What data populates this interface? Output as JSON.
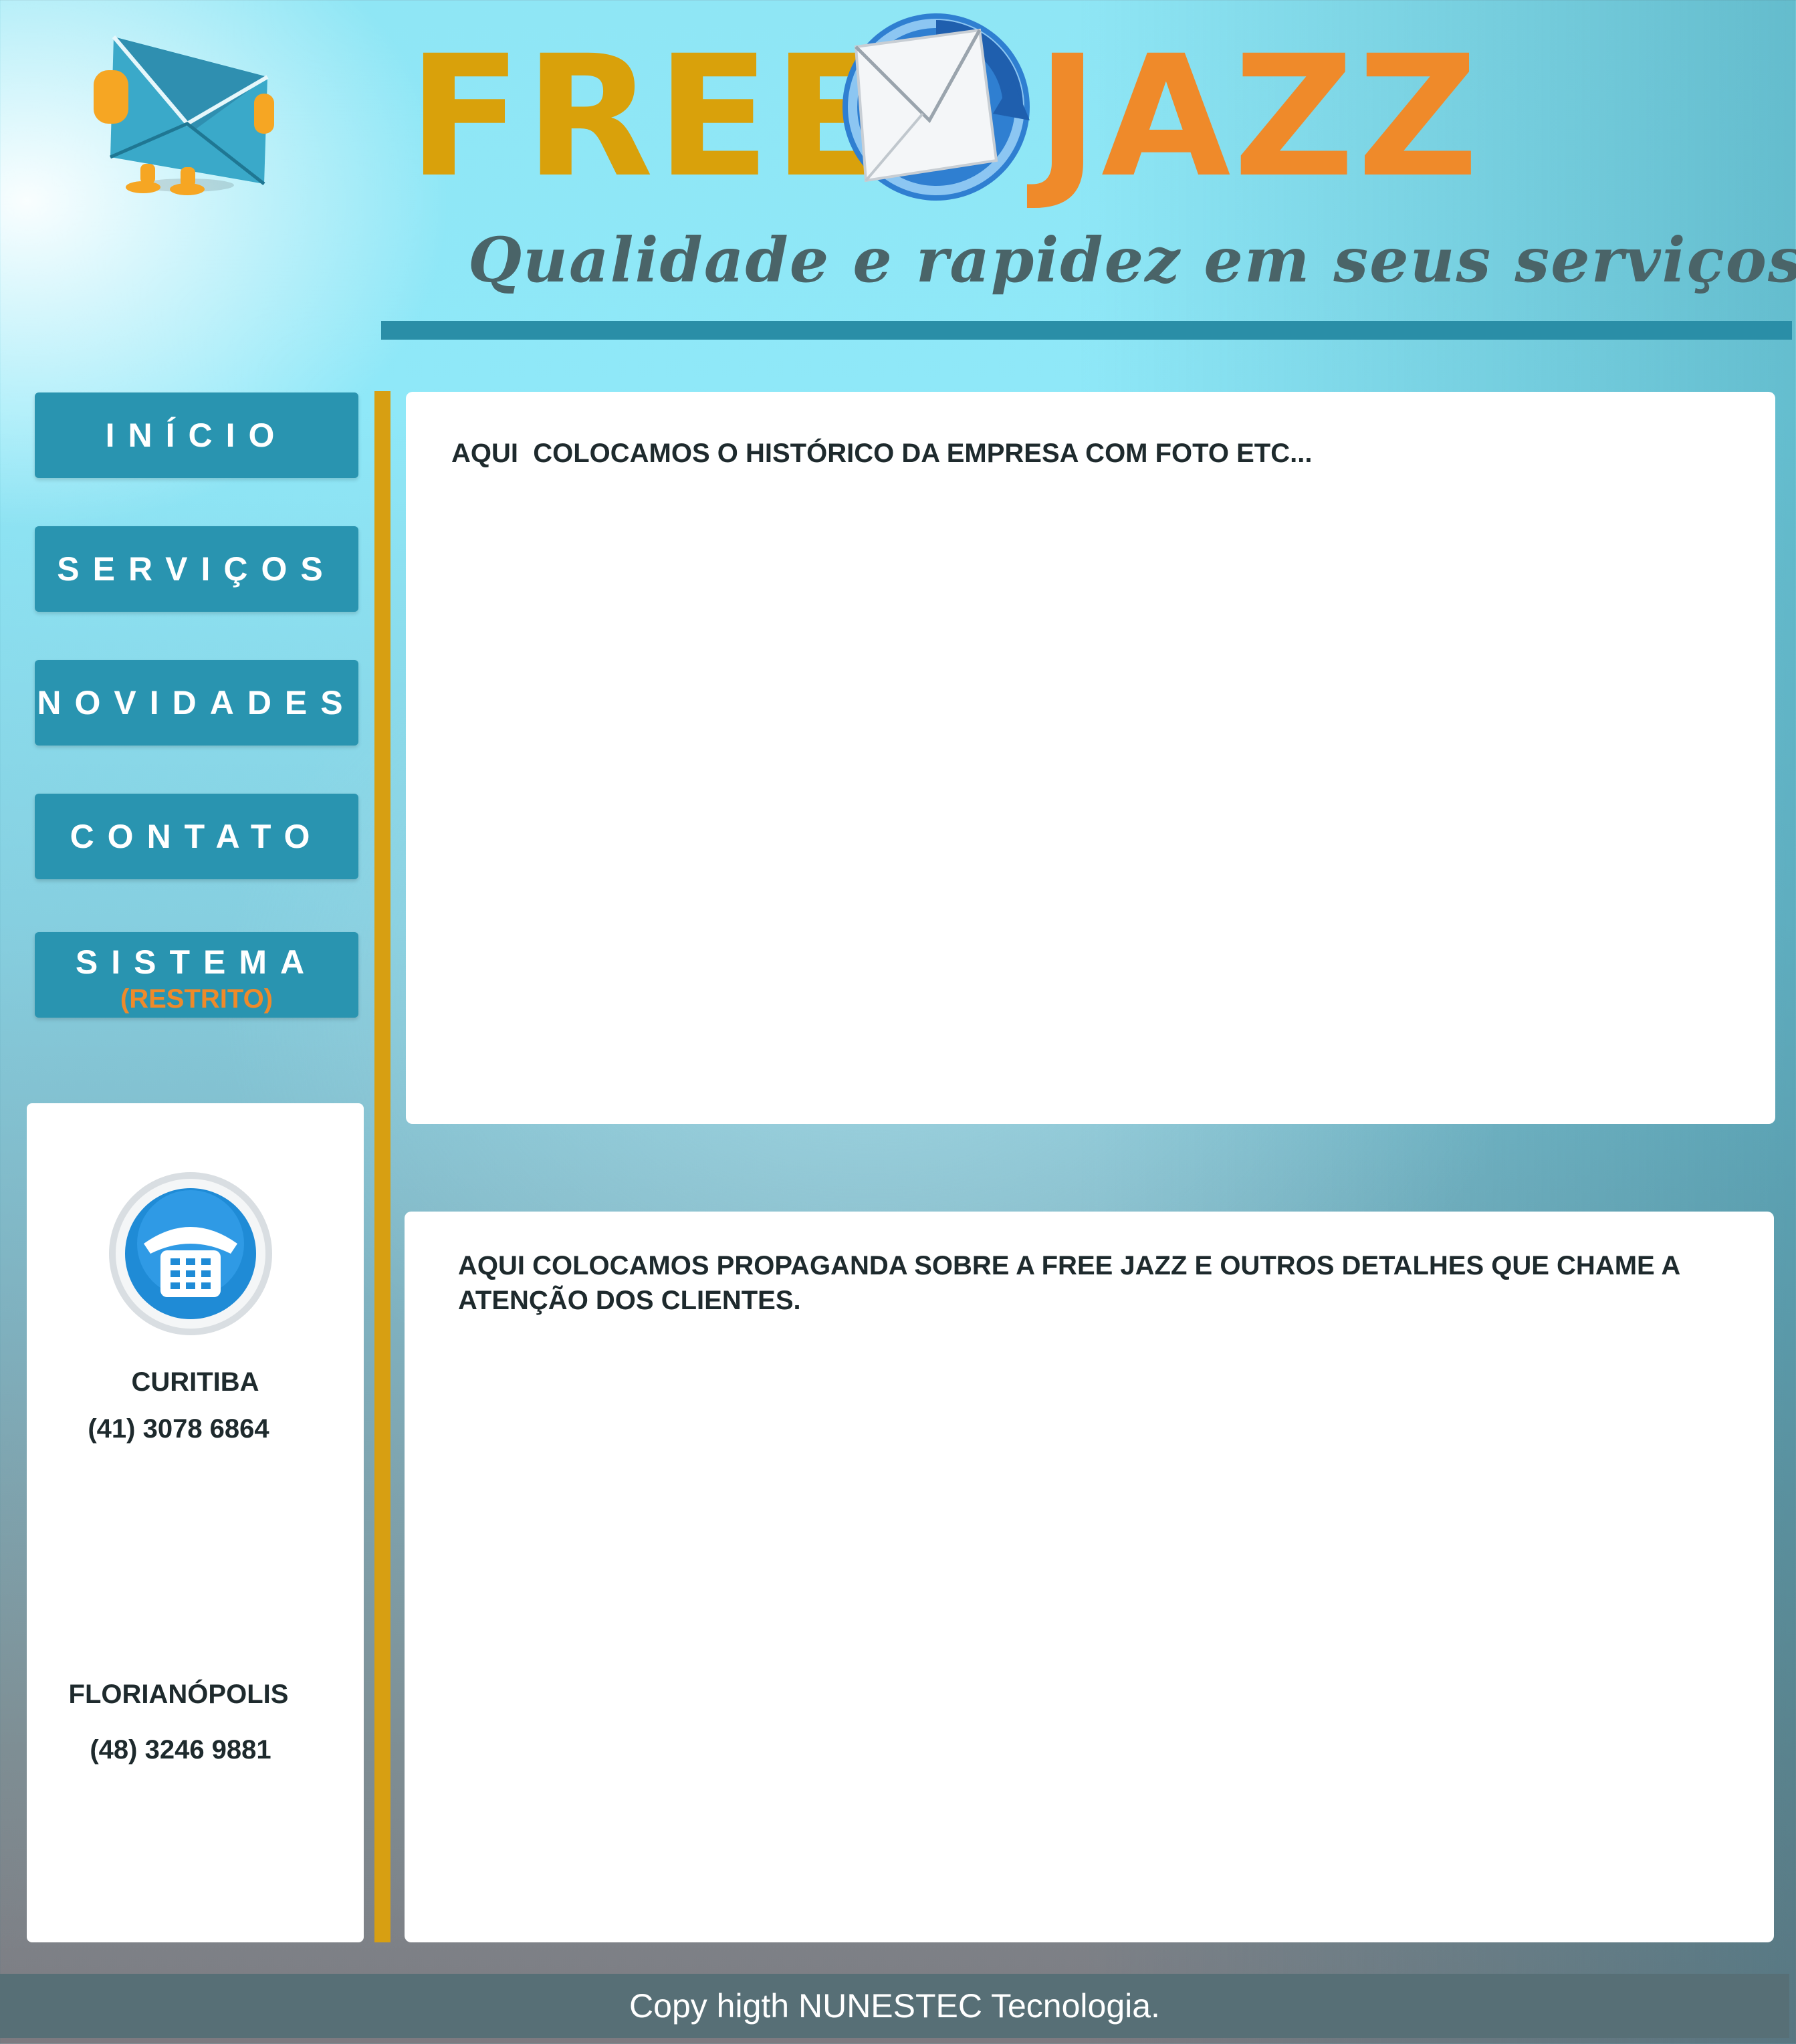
{
  "header": {
    "logo_part1": "FREE",
    "logo_part2": "JAZZ",
    "slogan": "Qualidade e rapidez em seus serviços"
  },
  "nav": {
    "items": [
      {
        "label": "INÍCIO"
      },
      {
        "label": "SERVIÇOS"
      },
      {
        "label": "NOVIDADES"
      },
      {
        "label": "CONTATO"
      },
      {
        "label": "SISTEMA",
        "sublabel": "(RESTRITO)"
      }
    ]
  },
  "contact": {
    "icon": "telephone-icon",
    "locations": [
      {
        "city": "CURITIBA",
        "phone": "(41) 3078 6864"
      },
      {
        "city": "FLORIANÓPOLIS",
        "phone": "(48) 3246 9881"
      }
    ]
  },
  "main": {
    "history_text": "AQUI  COLOCAMOS O HISTÓRICO DA EMPRESA COM FOTO ETC...",
    "promo_text": "AQUI COLOCAMOS PROPAGANDA SOBRE A FREE JAZZ E OUTROS DETALHES QUE CHAME A ATENÇÃO DOS CLIENTES."
  },
  "footer": {
    "text": "Copy higth NUNESTEC Tecnologia."
  },
  "colors": {
    "nav_button": "#2994b0",
    "logo_free": "#d9a10b",
    "logo_jazz": "#ef8a2a",
    "accent_bar": "#d79f12",
    "footer": "#576f76"
  }
}
